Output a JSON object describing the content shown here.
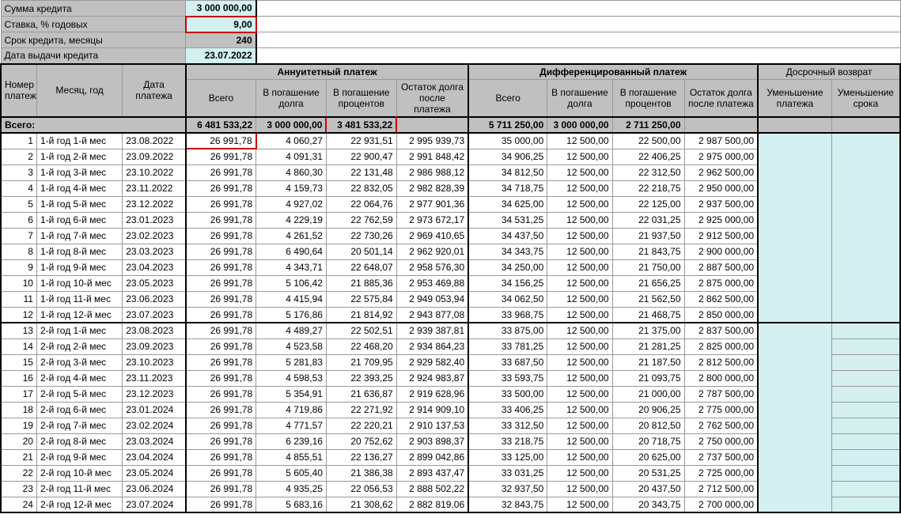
{
  "params": {
    "amount_label": "Сумма кредита",
    "amount_value": "3 000 000,00",
    "rate_label": "Ставка, % годовых",
    "rate_value": "9,00",
    "term_label": "Срок кредита, месяцы",
    "term_value": "240",
    "date_label": "Дата выдачи кредита",
    "date_value": "23.07.2022"
  },
  "headers": {
    "idx": "Номер платежа",
    "month": "Месяц, год",
    "date": "Дата платежа",
    "annuity_group": "Аннуитетный платеж",
    "diff_group": "Дифференцированный платеж",
    "early_group": "Досрочный возврат",
    "total_col": "Всего",
    "principal": "В погашение долга",
    "interest": "В погашение процентов",
    "balance": "Остаток долга после платежа",
    "reduce_payment": "Уменьшение платежа",
    "reduce_term": "Уменьшение срока",
    "totals_label": "Всего:"
  },
  "totals": {
    "a_total": "6 481 533,22",
    "a_principal": "3 000 000,00",
    "a_interest": "3 481 533,22",
    "d_total": "5 711 250,00",
    "d_principal": "3 000 000,00",
    "d_interest": "2 711 250,00"
  },
  "rows": [
    {
      "n": "1",
      "m": "1-й год 1-й мес",
      "d": "23.08.2022",
      "at": "26 991,78",
      "ap": "4 060,27",
      "ai": "22 931,51",
      "ab": "2 995 939,73",
      "dt": "35 000,00",
      "dp": "12 500,00",
      "di": "22 500,00",
      "db": "2 987 500,00"
    },
    {
      "n": "2",
      "m": "1-й год 2-й мес",
      "d": "23.09.2022",
      "at": "26 991,78",
      "ap": "4 091,31",
      "ai": "22 900,47",
      "ab": "2 991 848,42",
      "dt": "34 906,25",
      "dp": "12 500,00",
      "di": "22 406,25",
      "db": "2 975 000,00"
    },
    {
      "n": "3",
      "m": "1-й год 3-й мес",
      "d": "23.10.2022",
      "at": "26 991,78",
      "ap": "4 860,30",
      "ai": "22 131,48",
      "ab": "2 986 988,12",
      "dt": "34 812,50",
      "dp": "12 500,00",
      "di": "22 312,50",
      "db": "2 962 500,00"
    },
    {
      "n": "4",
      "m": "1-й год 4-й мес",
      "d": "23.11.2022",
      "at": "26 991,78",
      "ap": "4 159,73",
      "ai": "22 832,05",
      "ab": "2 982 828,39",
      "dt": "34 718,75",
      "dp": "12 500,00",
      "di": "22 218,75",
      "db": "2 950 000,00"
    },
    {
      "n": "5",
      "m": "1-й год 5-й мес",
      "d": "23.12.2022",
      "at": "26 991,78",
      "ap": "4 927,02",
      "ai": "22 064,76",
      "ab": "2 977 901,36",
      "dt": "34 625,00",
      "dp": "12 500,00",
      "di": "22 125,00",
      "db": "2 937 500,00"
    },
    {
      "n": "6",
      "m": "1-й год 6-й мес",
      "d": "23.01.2023",
      "at": "26 991,78",
      "ap": "4 229,19",
      "ai": "22 762,59",
      "ab": "2 973 672,17",
      "dt": "34 531,25",
      "dp": "12 500,00",
      "di": "22 031,25",
      "db": "2 925 000,00"
    },
    {
      "n": "7",
      "m": "1-й год 7-й мес",
      "d": "23.02.2023",
      "at": "26 991,78",
      "ap": "4 261,52",
      "ai": "22 730,26",
      "ab": "2 969 410,65",
      "dt": "34 437,50",
      "dp": "12 500,00",
      "di": "21 937,50",
      "db": "2 912 500,00"
    },
    {
      "n": "8",
      "m": "1-й год 8-й мес",
      "d": "23.03.2023",
      "at": "26 991,78",
      "ap": "6 490,64",
      "ai": "20 501,14",
      "ab": "2 962 920,01",
      "dt": "34 343,75",
      "dp": "12 500,00",
      "di": "21 843,75",
      "db": "2 900 000,00"
    },
    {
      "n": "9",
      "m": "1-й год 9-й мес",
      "d": "23.04.2023",
      "at": "26 991,78",
      "ap": "4 343,71",
      "ai": "22 648,07",
      "ab": "2 958 576,30",
      "dt": "34 250,00",
      "dp": "12 500,00",
      "di": "21 750,00",
      "db": "2 887 500,00"
    },
    {
      "n": "10",
      "m": "1-й год 10-й мес",
      "d": "23.05.2023",
      "at": "26 991,78",
      "ap": "5 106,42",
      "ai": "21 885,36",
      "ab": "2 953 469,88",
      "dt": "34 156,25",
      "dp": "12 500,00",
      "di": "21 656,25",
      "db": "2 875 000,00"
    },
    {
      "n": "11",
      "m": "1-й год 11-й мес",
      "d": "23.06.2023",
      "at": "26 991,78",
      "ap": "4 415,94",
      "ai": "22 575,84",
      "ab": "2 949 053,94",
      "dt": "34 062,50",
      "dp": "12 500,00",
      "di": "21 562,50",
      "db": "2 862 500,00"
    },
    {
      "n": "12",
      "m": "1-й год 12-й мес",
      "d": "23.07.2023",
      "at": "26 991,78",
      "ap": "5 176,86",
      "ai": "21 814,92",
      "ab": "2 943 877,08",
      "dt": "33 968,75",
      "dp": "12 500,00",
      "di": "21 468,75",
      "db": "2 850 000,00"
    },
    {
      "n": "13",
      "m": "2-й год 1-й мес",
      "d": "23.08.2023",
      "at": "26 991,78",
      "ap": "4 489,27",
      "ai": "22 502,51",
      "ab": "2 939 387,81",
      "dt": "33 875,00",
      "dp": "12 500,00",
      "di": "21 375,00",
      "db": "2 837 500,00"
    },
    {
      "n": "14",
      "m": "2-й год 2-й мес",
      "d": "23.09.2023",
      "at": "26 991,78",
      "ap": "4 523,58",
      "ai": "22 468,20",
      "ab": "2 934 864,23",
      "dt": "33 781,25",
      "dp": "12 500,00",
      "di": "21 281,25",
      "db": "2 825 000,00"
    },
    {
      "n": "15",
      "m": "2-й год 3-й мес",
      "d": "23.10.2023",
      "at": "26 991,78",
      "ap": "5 281,83",
      "ai": "21 709,95",
      "ab": "2 929 582,40",
      "dt": "33 687,50",
      "dp": "12 500,00",
      "di": "21 187,50",
      "db": "2 812 500,00"
    },
    {
      "n": "16",
      "m": "2-й год 4-й мес",
      "d": "23.11.2023",
      "at": "26 991,78",
      "ap": "4 598,53",
      "ai": "22 393,25",
      "ab": "2 924 983,87",
      "dt": "33 593,75",
      "dp": "12 500,00",
      "di": "21 093,75",
      "db": "2 800 000,00"
    },
    {
      "n": "17",
      "m": "2-й год 5-й мес",
      "d": "23.12.2023",
      "at": "26 991,78",
      "ap": "5 354,91",
      "ai": "21 636,87",
      "ab": "2 919 628,96",
      "dt": "33 500,00",
      "dp": "12 500,00",
      "di": "21 000,00",
      "db": "2 787 500,00"
    },
    {
      "n": "18",
      "m": "2-й год 6-й мес",
      "d": "23.01.2024",
      "at": "26 991,78",
      "ap": "4 719,86",
      "ai": "22 271,92",
      "ab": "2 914 909,10",
      "dt": "33 406,25",
      "dp": "12 500,00",
      "di": "20 906,25",
      "db": "2 775 000,00"
    },
    {
      "n": "19",
      "m": "2-й год 7-й мес",
      "d": "23.02.2024",
      "at": "26 991,78",
      "ap": "4 771,57",
      "ai": "22 220,21",
      "ab": "2 910 137,53",
      "dt": "33 312,50",
      "dp": "12 500,00",
      "di": "20 812,50",
      "db": "2 762 500,00"
    },
    {
      "n": "20",
      "m": "2-й год 8-й мес",
      "d": "23.03.2024",
      "at": "26 991,78",
      "ap": "6 239,16",
      "ai": "20 752,62",
      "ab": "2 903 898,37",
      "dt": "33 218,75",
      "dp": "12 500,00",
      "di": "20 718,75",
      "db": "2 750 000,00"
    },
    {
      "n": "21",
      "m": "2-й год 9-й мес",
      "d": "23.04.2024",
      "at": "26 991,78",
      "ap": "4 855,51",
      "ai": "22 136,27",
      "ab": "2 899 042,86",
      "dt": "33 125,00",
      "dp": "12 500,00",
      "di": "20 625,00",
      "db": "2 737 500,00"
    },
    {
      "n": "22",
      "m": "2-й год 10-й мес",
      "d": "23.05.2024",
      "at": "26 991,78",
      "ap": "5 605,40",
      "ai": "21 386,38",
      "ab": "2 893 437,47",
      "dt": "33 031,25",
      "dp": "12 500,00",
      "di": "20 531,25",
      "db": "2 725 000,00"
    },
    {
      "n": "23",
      "m": "2-й год 11-й мес",
      "d": "23.06.2024",
      "at": "26 991,78",
      "ap": "4 935,25",
      "ai": "22 056,53",
      "ab": "2 888 502,22",
      "dt": "32 937,50",
      "dp": "12 500,00",
      "di": "20 437,50",
      "db": "2 712 500,00"
    },
    {
      "n": "24",
      "m": "2-й год 12-й мес",
      "d": "23.07.2024",
      "at": "26 991,78",
      "ap": "5 683,16",
      "ai": "21 308,62",
      "ab": "2 882 819,06",
      "dt": "32 843,75",
      "dp": "12 500,00",
      "di": "20 343,75",
      "db": "2 700 000,00"
    }
  ]
}
